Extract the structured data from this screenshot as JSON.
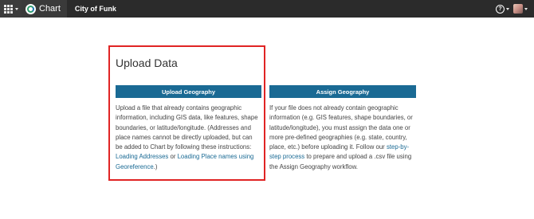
{
  "header": {
    "brand": "Chart",
    "org": "City of Funk",
    "help_glyph": "?"
  },
  "upload": {
    "title": "Upload Data",
    "button": "Upload Geography",
    "text_before": "Upload a file that already contains geographic information, including GIS data, like features, shape boundaries, or latitude/longitude. (Addresses and place names cannot be directly uploaded, but can be added to Chart by following these instructions: ",
    "link1": "Loading Addresses",
    "text_mid": " or ",
    "link2": "Loading Place names using Georeference",
    "text_after": ".)"
  },
  "assign": {
    "button": "Assign Geography",
    "text_before": "If your file does not already contain geographic information (e.g. GIS features, shape boundaries, or latitude/longitude), you must assign the data one or more pre-defined geographies (e.g. state, country, place, etc.) before uploading it. Follow our ",
    "link": "step-by-step process",
    "text_after": " to prepare and upload a .csv file using the Assign Geography workflow."
  },
  "colors": {
    "topbar": "#2b2b2b",
    "button": "#1a6a94",
    "highlight_border": "#e02424",
    "link": "#1a6a94"
  },
  "icons": [
    "apps-grid-icon",
    "chart-logo-icon",
    "help-icon",
    "user-avatar"
  ]
}
